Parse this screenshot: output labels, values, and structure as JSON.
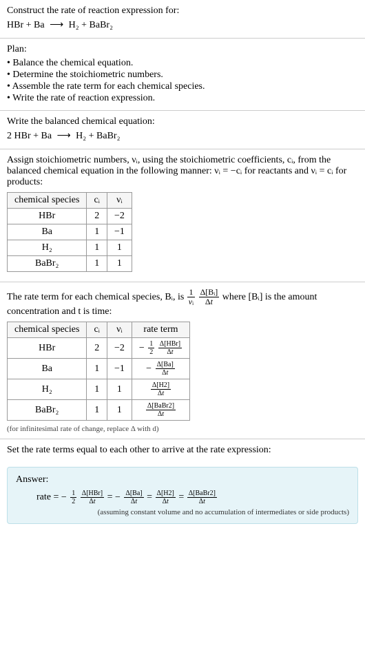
{
  "intro": {
    "heading": "Construct the rate of reaction expression for:",
    "equation_lhs": "HBr + Ba",
    "equation_rhs": "H₂ + BaBr₂"
  },
  "plan": {
    "heading": "Plan:",
    "bullets": [
      "• Balance the chemical equation.",
      "• Determine the stoichiometric numbers.",
      "• Assemble the rate term for each chemical species.",
      "• Write the rate of reaction expression."
    ]
  },
  "balanced": {
    "heading": "Write the balanced chemical equation:",
    "equation_lhs": "2 HBr + Ba",
    "equation_rhs": "H₂ + BaBr₂"
  },
  "stoich": {
    "text1": "Assign stoichiometric numbers, νᵢ, using the stoichiometric coefficients, cᵢ, from the balanced chemical equation in the following manner: νᵢ = −cᵢ for reactants and νᵢ = cᵢ for products:",
    "headers": [
      "chemical species",
      "cᵢ",
      "νᵢ"
    ],
    "rows": [
      {
        "species": "HBr",
        "c": "2",
        "nu": "−2"
      },
      {
        "species": "Ba",
        "c": "1",
        "nu": "−1"
      },
      {
        "species": "H₂",
        "c": "1",
        "nu": "1"
      },
      {
        "species": "BaBr₂",
        "c": "1",
        "nu": "1"
      }
    ]
  },
  "rateterm": {
    "text_pre": "The rate term for each chemical species, Bᵢ, is ",
    "text_mid": " where [Bᵢ] is the amount concentration and t is time:",
    "headers": [
      "chemical species",
      "cᵢ",
      "νᵢ",
      "rate term"
    ],
    "rows": [
      {
        "species": "HBr",
        "c": "2",
        "nu": "−2",
        "neg": "−",
        "coef_num": "1",
        "coef_den": "2",
        "delta": "Δ[HBr]"
      },
      {
        "species": "Ba",
        "c": "1",
        "nu": "−1",
        "neg": "−",
        "coef_num": "",
        "coef_den": "",
        "delta": "Δ[Ba]"
      },
      {
        "species": "H₂",
        "c": "1",
        "nu": "1",
        "neg": "",
        "coef_num": "",
        "coef_den": "",
        "delta": "Δ[H2]"
      },
      {
        "species": "BaBr₂",
        "c": "1",
        "nu": "1",
        "neg": "",
        "coef_num": "",
        "coef_den": "",
        "delta": "Δ[BaBr2]"
      }
    ],
    "note": "(for infinitesimal rate of change, replace Δ with d)"
  },
  "final": {
    "heading": "Set the rate terms equal to each other to arrive at the rate expression:"
  },
  "answer": {
    "label": "Answer:",
    "prefix": "rate = ",
    "terms": [
      {
        "neg": "−",
        "coef_num": "1",
        "coef_den": "2",
        "delta": "Δ[HBr]"
      },
      {
        "neg": "−",
        "coef_num": "",
        "coef_den": "",
        "delta": "Δ[Ba]"
      },
      {
        "neg": "",
        "coef_num": "",
        "coef_den": "",
        "delta": "Δ[H2]"
      },
      {
        "neg": "",
        "coef_num": "",
        "coef_den": "",
        "delta": "Δ[BaBr2]"
      }
    ],
    "note": "(assuming constant volume and no accumulation of intermediates or side products)"
  },
  "chart_data": {
    "type": "table",
    "tables": [
      {
        "title": "Stoichiometric numbers",
        "columns": [
          "chemical species",
          "c_i",
          "nu_i"
        ],
        "rows": [
          [
            "HBr",
            2,
            -2
          ],
          [
            "Ba",
            1,
            -1
          ],
          [
            "H2",
            1,
            1
          ],
          [
            "BaBr2",
            1,
            1
          ]
        ]
      },
      {
        "title": "Rate terms",
        "columns": [
          "chemical species",
          "c_i",
          "nu_i",
          "rate term"
        ],
        "rows": [
          [
            "HBr",
            2,
            -2,
            "-(1/2) Δ[HBr]/Δt"
          ],
          [
            "Ba",
            1,
            -1,
            "-Δ[Ba]/Δt"
          ],
          [
            "H2",
            1,
            1,
            "Δ[H2]/Δt"
          ],
          [
            "BaBr2",
            1,
            1,
            "Δ[BaBr2]/Δt"
          ]
        ]
      }
    ],
    "rate_expression": "rate = -(1/2) Δ[HBr]/Δt = -Δ[Ba]/Δt = Δ[H2]/Δt = Δ[BaBr2]/Δt"
  }
}
